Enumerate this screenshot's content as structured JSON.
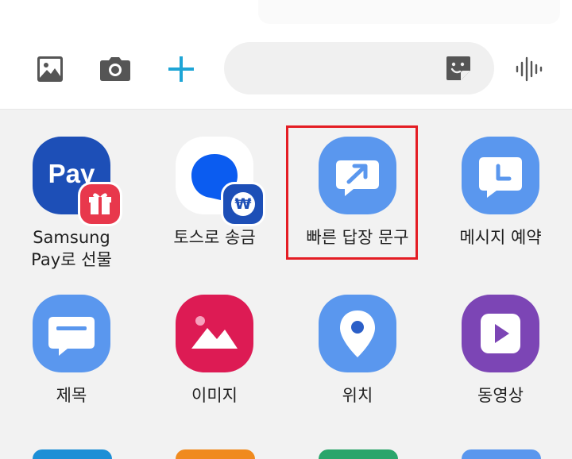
{
  "toolbar": {
    "icons": [
      "gallery-icon",
      "camera-icon",
      "plus-icon",
      "sticker-icon",
      "voice-icon"
    ],
    "accent_color": "#1ea5d6"
  },
  "message_input": {
    "placeholder": ""
  },
  "apps": [
    {
      "label": "Samsung\nPay로 선물",
      "icon": "samsung-pay-icon",
      "tile_text": "Pay",
      "color": "#1d4fb7"
    },
    {
      "label": "토스로 송금",
      "icon": "toss-icon",
      "badge_text": "₩",
      "color": "#ffffff"
    },
    {
      "label": "빠른 답장 문구",
      "icon": "quick-reply-icon",
      "color": "#5a97ee",
      "highlighted": true
    },
    {
      "label": "메시지 예약",
      "icon": "schedule-message-icon",
      "color": "#5a97ee"
    },
    {
      "label": "제목",
      "icon": "subject-icon",
      "color": "#5a97ee"
    },
    {
      "label": "이미지",
      "icon": "image-icon",
      "color": "#dd1b54"
    },
    {
      "label": "위치",
      "icon": "location-icon",
      "color": "#5a97ee"
    },
    {
      "label": "동영상",
      "icon": "video-icon",
      "color": "#7c45b5"
    }
  ],
  "highlight_color": "#e41d24"
}
